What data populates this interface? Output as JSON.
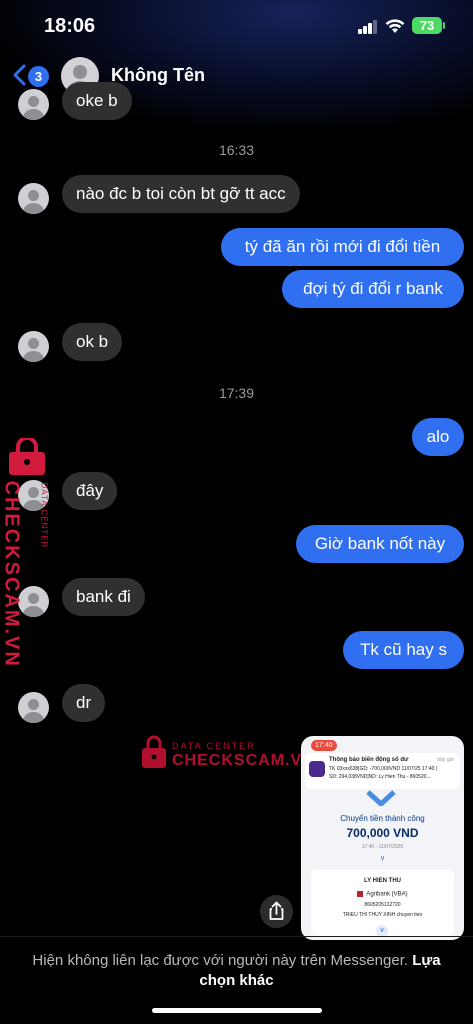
{
  "status_bar": {
    "time": "18:06",
    "battery": "73"
  },
  "header": {
    "back_count": "3",
    "contact_name": "Không Tên"
  },
  "messages": [
    {
      "dir": "in",
      "text": "oke b"
    },
    {
      "timestamp": "16:33"
    },
    {
      "dir": "in",
      "text": "nào đc b toi còn bt gỡ tt acc"
    },
    {
      "dir": "out",
      "text": "tý đã ăn rồi mới đi đổi tiền"
    },
    {
      "dir": "out",
      "text": "đợi tý đi đổi r bank"
    },
    {
      "dir": "in",
      "text": "ok b"
    },
    {
      "timestamp": "17:39"
    },
    {
      "dir": "out",
      "text": "alo"
    },
    {
      "dir": "in",
      "text": "đây"
    },
    {
      "dir": "out",
      "text": "Giờ bank nốt này"
    },
    {
      "dir": "in",
      "text": "bank đi"
    },
    {
      "dir": "out",
      "text": "Tk cũ hay s"
    },
    {
      "dir": "in",
      "text": "dr"
    }
  ],
  "watermark": {
    "brand": "CHECKSCAM.VN",
    "tag": "DATA CENTER"
  },
  "attachment": {
    "status_time": "17:40",
    "notif_title": "Thông báo biến động số dư",
    "notif_ago": "bây giờ",
    "notif_line1": "TK 03xxx638|GD: -700,000VND 11/07/25 17:40 |",
    "notif_line2": "SD: 294,038VND|ND: Ly Hien Thu - 860520...",
    "success_label": "Chuyển tiền thành công",
    "amount": "700,000 VND",
    "date": "17:40 - 11/07/2025",
    "recipient_name": "LY HIEN THU",
    "bank": "Agribank (VBA)",
    "account": "8605205132720",
    "description": "TRIEU THI THUY XINH chuyen tien"
  },
  "footer": {
    "notice": "Hiện không liên lạc được với người này trên Messenger.",
    "link": "Lựa chọn khác"
  }
}
